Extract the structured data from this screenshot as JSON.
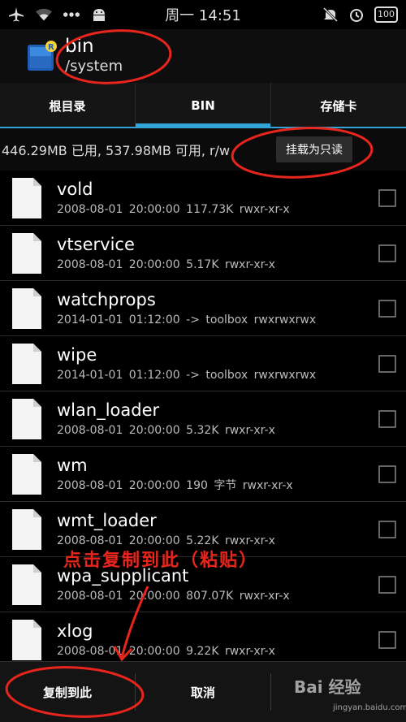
{
  "status_bar": {
    "time": "周一 14:51",
    "battery": "100",
    "icons": [
      "airplane-icon",
      "wifi-icon",
      "more-icon",
      "android-icon",
      "mute-icon",
      "alarm-icon",
      "battery-icon"
    ]
  },
  "action_bar": {
    "title": "bin",
    "subtitle": "/system",
    "app_icon": "root-explorer-icon"
  },
  "tabs": [
    {
      "label": "根目录",
      "active": false
    },
    {
      "label": "BIN",
      "active": true
    },
    {
      "label": "存储卡",
      "active": false
    }
  ],
  "info": {
    "text": "446.29MB 已用, 537.98MB 可用, r/w",
    "mount_button": "挂载为只读"
  },
  "files": [
    {
      "name": "vold",
      "date": "2008-08-01 20:00:00",
      "size": "117.73K",
      "perms": "rwxr-xr-x"
    },
    {
      "name": "vtservice",
      "date": "2008-08-01 20:00:00",
      "size": "5.17K",
      "perms": "rwxr-xr-x"
    },
    {
      "name": "watchprops",
      "date": "2014-01-01 01:12:00",
      "size": "-> toolbox",
      "perms": "rwxrwxrwx"
    },
    {
      "name": "wipe",
      "date": "2014-01-01 01:12:00",
      "size": "-> toolbox",
      "perms": "rwxrwxrwx"
    },
    {
      "name": "wlan_loader",
      "date": "2008-08-01 20:00:00",
      "size": "5.32K",
      "perms": "rwxr-xr-x"
    },
    {
      "name": "wm",
      "date": "2008-08-01 20:00:00",
      "size": "190 字节",
      "perms": "rwxr-xr-x"
    },
    {
      "name": "wmt_loader",
      "date": "2008-08-01 20:00:00",
      "size": "5.22K",
      "perms": "rwxr-xr-x"
    },
    {
      "name": "wpa_supplicant",
      "date": "2008-08-01 20:00:00",
      "size": "807.07K",
      "perms": "rwxr-xr-x"
    },
    {
      "name": "xlog",
      "date": "2008-08-01 20:00:00",
      "size": "9.22K",
      "perms": "rwxr-xr-x"
    }
  ],
  "bottom_bar": {
    "copy_here": "复制到此",
    "cancel": "取消"
  },
  "annotation": {
    "text": "点击复制到此（粘贴）",
    "color": "#e8251c"
  },
  "watermark": {
    "text": "Bai 经验",
    "sub": "jingyan.baidu.com"
  },
  "colors": {
    "accent": "#33a4d6",
    "annotation": "#e8251c"
  }
}
